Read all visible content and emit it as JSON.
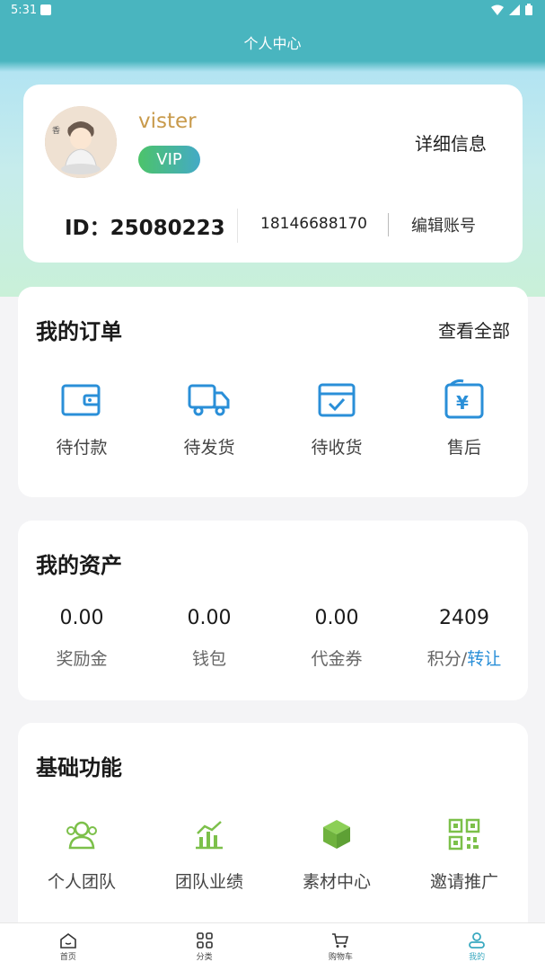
{
  "status_bar": {
    "time": "5:31"
  },
  "header": {
    "title": "个人中心"
  },
  "profile": {
    "username": "vister",
    "badge": "VIP",
    "detail_link": "详细信息",
    "user_id": "ID：25080223",
    "phone": "18146688170",
    "edit_account": "编辑账号"
  },
  "orders": {
    "title": "我的订单",
    "view_all": "查看全部",
    "items": [
      {
        "label": "待付款",
        "icon": "wallet-icon"
      },
      {
        "label": "待发货",
        "icon": "truck-icon"
      },
      {
        "label": "待收货",
        "icon": "package-check-icon"
      },
      {
        "label": "售后",
        "icon": "yen-refund-icon"
      }
    ]
  },
  "assets": {
    "title": "我的资产",
    "items": [
      {
        "value": "0.00",
        "label": "奖励金"
      },
      {
        "value": "0.00",
        "label": "钱包"
      },
      {
        "value": "0.00",
        "label": "代金券"
      },
      {
        "value": "2409",
        "label": "积分/",
        "link": "转让"
      }
    ]
  },
  "functions": {
    "title": "基础功能",
    "items": [
      {
        "label": "个人团队",
        "icon": "team-icon"
      },
      {
        "label": "团队业绩",
        "icon": "chart-icon"
      },
      {
        "label": "素材中心",
        "icon": "cube-icon"
      },
      {
        "label": "邀请推广",
        "icon": "qr-code-icon"
      }
    ]
  },
  "tabbar": {
    "items": [
      {
        "label": "首页",
        "icon": "home-icon"
      },
      {
        "label": "分类",
        "icon": "grid-icon"
      },
      {
        "label": "购物车",
        "icon": "cart-icon"
      },
      {
        "label": "我的",
        "icon": "user-icon"
      }
    ],
    "active_index": 3
  },
  "colors": {
    "header": "#49b5bf",
    "accent_blue": "#2a8fd8",
    "accent_green": "#7cc04a",
    "username": "#c89a4b"
  }
}
